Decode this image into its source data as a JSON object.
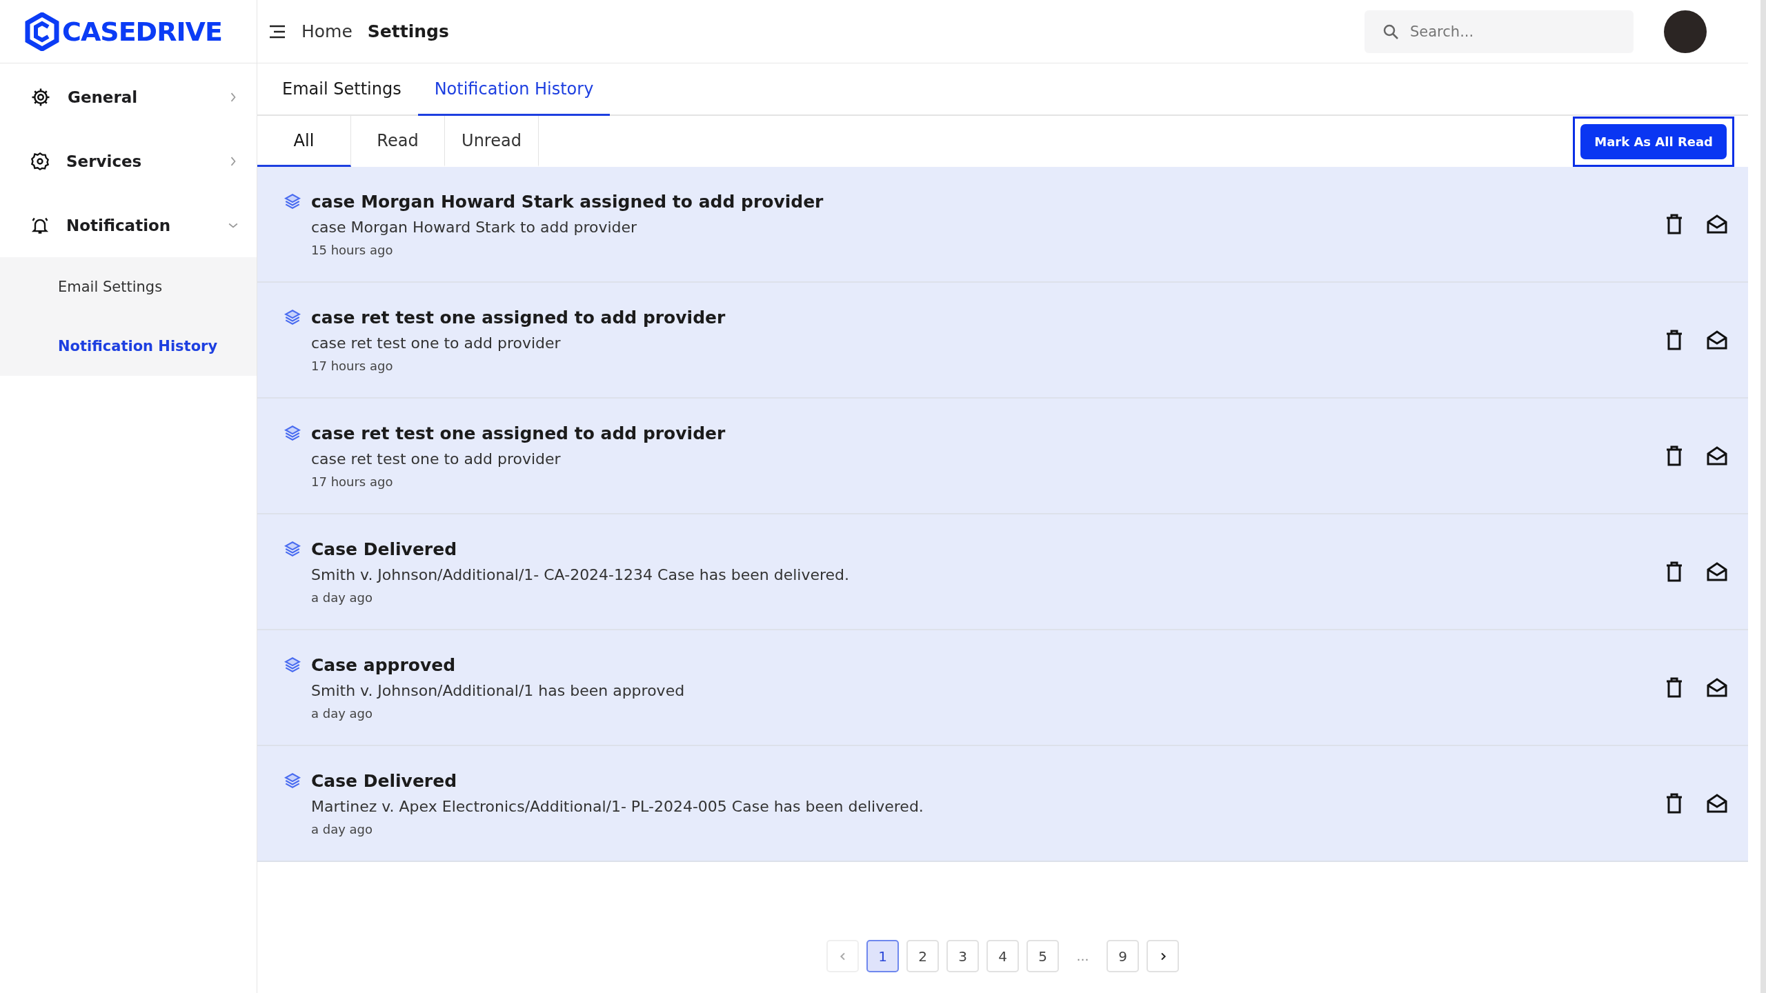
{
  "logo": {
    "text": "CASEDRIVE"
  },
  "sidebar": {
    "items": [
      {
        "label": "General",
        "expanded": false
      },
      {
        "label": "Services",
        "expanded": false
      },
      {
        "label": "Notification",
        "expanded": true,
        "children": [
          {
            "label": "Email Settings",
            "selected": false
          },
          {
            "label": "Notification History",
            "selected": true
          }
        ]
      }
    ]
  },
  "topbar": {
    "breadcrumb": [
      "Home",
      "Settings"
    ],
    "search": {
      "placeholder": "Search..."
    }
  },
  "tabs": [
    {
      "label": "Email Settings",
      "selected": false
    },
    {
      "label": "Notification History",
      "selected": true
    }
  ],
  "filters": [
    {
      "label": "All",
      "selected": true
    },
    {
      "label": "Read",
      "selected": false
    },
    {
      "label": "Unread",
      "selected": false
    }
  ],
  "mark_all_button": "Mark As All Read",
  "notifications": [
    {
      "title": "case Morgan Howard Stark assigned to add provider",
      "message": "case Morgan Howard Stark to add provider",
      "time": "15 hours ago",
      "read": false
    },
    {
      "title": "case ret test one assigned to add provider",
      "message": "case ret test one to add provider",
      "time": "17 hours ago",
      "read": false
    },
    {
      "title": "case ret test one assigned to add provider",
      "message": "case ret test one to add provider",
      "time": "17 hours ago",
      "read": false
    },
    {
      "title": "Case Delivered",
      "message": "Smith v. Johnson/Additional/1- CA-2024-1234 Case has been delivered.",
      "time": "a day ago",
      "read": false
    },
    {
      "title": "Case approved",
      "message": "Smith v. Johnson/Additional/1 has been approved",
      "time": "a day ago",
      "read": false
    },
    {
      "title": "Case Delivered",
      "message": "Martinez v. Apex Electronics/Additional/1- PL-2024-005 Case has been delivered.",
      "time": "a day ago",
      "read": false
    }
  ],
  "pagination": {
    "pages": [
      {
        "label": "1",
        "selected": true
      },
      {
        "label": "2",
        "selected": false
      },
      {
        "label": "3",
        "selected": false
      },
      {
        "label": "4",
        "selected": false
      },
      {
        "label": "5",
        "selected": false
      },
      {
        "label": "…",
        "kind": "ellipsis"
      },
      {
        "label": "9",
        "selected": false
      }
    ],
    "prev_disabled": true
  }
}
